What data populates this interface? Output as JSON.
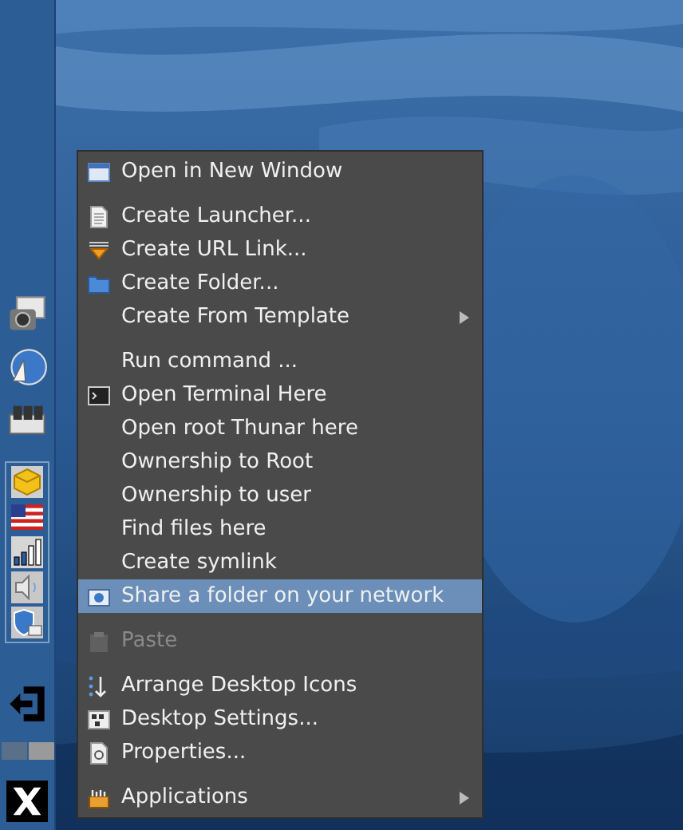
{
  "panel": {
    "workspaces": [
      {
        "selected": true
      },
      {
        "selected": false
      }
    ]
  },
  "context_menu": {
    "items": [
      {
        "kind": "item",
        "label": "Open in New Window",
        "disabled": false,
        "selected": false,
        "submenu": false
      },
      {
        "kind": "separator"
      },
      {
        "kind": "item",
        "label": "Create Launcher...",
        "disabled": false,
        "selected": false,
        "submenu": false
      },
      {
        "kind": "item",
        "label": "Create URL Link...",
        "disabled": false,
        "selected": false,
        "submenu": false
      },
      {
        "kind": "item",
        "label": "Create Folder...",
        "disabled": false,
        "selected": false,
        "submenu": false
      },
      {
        "kind": "item",
        "label": "Create From Template",
        "disabled": false,
        "selected": false,
        "submenu": true
      },
      {
        "kind": "separator"
      },
      {
        "kind": "item",
        "label": "Run command ...",
        "disabled": false,
        "selected": false,
        "submenu": false
      },
      {
        "kind": "item",
        "label": "Open Terminal Here",
        "disabled": false,
        "selected": false,
        "submenu": false
      },
      {
        "kind": "item",
        "label": "Open root Thunar here",
        "disabled": false,
        "selected": false,
        "submenu": false
      },
      {
        "kind": "item",
        "label": "Ownership to Root",
        "disabled": false,
        "selected": false,
        "submenu": false
      },
      {
        "kind": "item",
        "label": "Ownership to user",
        "disabled": false,
        "selected": false,
        "submenu": false
      },
      {
        "kind": "item",
        "label": "Find files here",
        "disabled": false,
        "selected": false,
        "submenu": false
      },
      {
        "kind": "item",
        "label": "Create symlink",
        "disabled": false,
        "selected": false,
        "submenu": false
      },
      {
        "kind": "item",
        "label": "Share a folder on your network",
        "disabled": false,
        "selected": true,
        "submenu": false
      },
      {
        "kind": "separator"
      },
      {
        "kind": "item",
        "label": "Paste",
        "disabled": true,
        "selected": false,
        "submenu": false
      },
      {
        "kind": "separator"
      },
      {
        "kind": "item",
        "label": "Arrange Desktop Icons",
        "disabled": false,
        "selected": false,
        "submenu": false
      },
      {
        "kind": "item",
        "label": "Desktop Settings...",
        "disabled": false,
        "selected": false,
        "submenu": false
      },
      {
        "kind": "item",
        "label": "Properties...",
        "disabled": false,
        "selected": false,
        "submenu": false
      },
      {
        "kind": "separator"
      },
      {
        "kind": "item",
        "label": "Applications",
        "disabled": false,
        "selected": false,
        "submenu": true
      }
    ]
  }
}
